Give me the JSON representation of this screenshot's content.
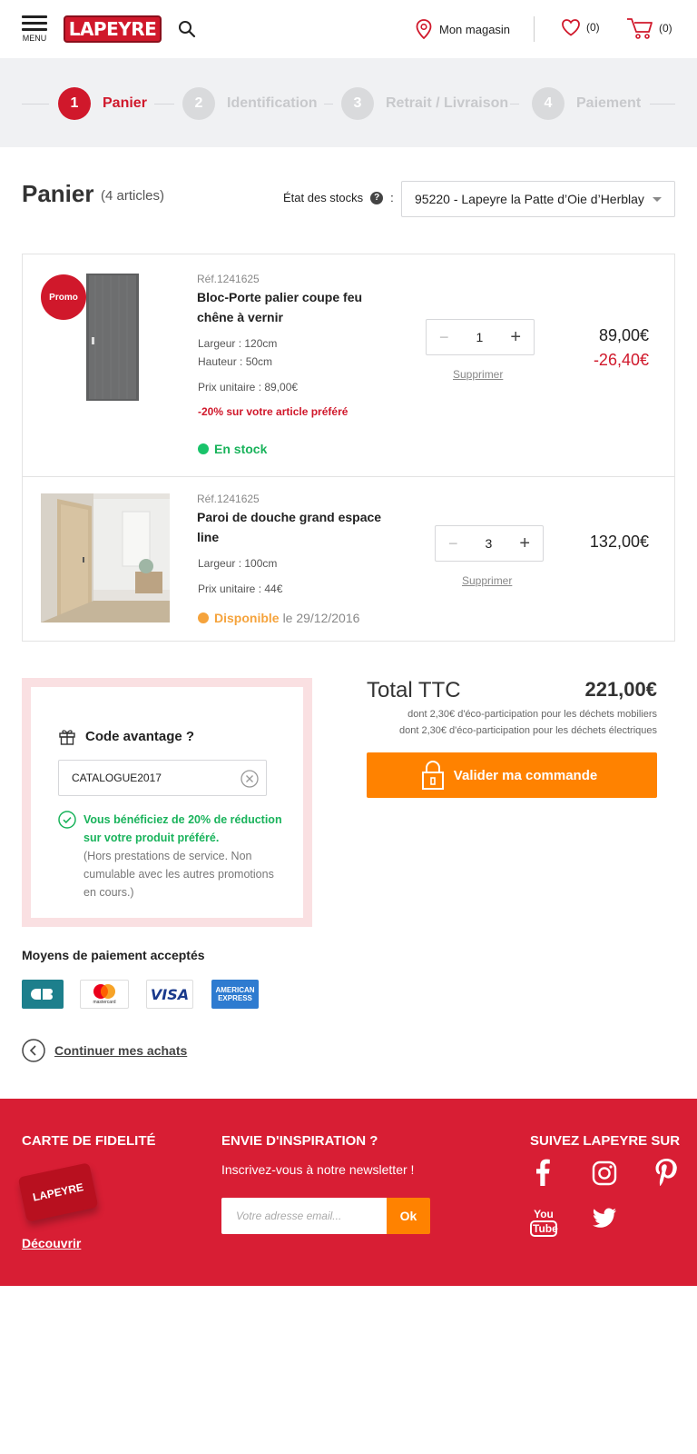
{
  "header": {
    "menu_label": "MENU",
    "logo_text": "LAPEYRE",
    "store_label": "Mon magasin",
    "favorites_count": "(0)",
    "cart_count": "(0)"
  },
  "stepper": [
    {
      "number": "1",
      "label": "Panier",
      "active": true
    },
    {
      "number": "2",
      "label": "Identification",
      "active": false
    },
    {
      "number": "3",
      "label": "Retrait / Livraison",
      "active": false
    },
    {
      "number": "4",
      "label": "Paiement",
      "active": false
    }
  ],
  "cart": {
    "title": "Panier",
    "count_label": "(4 articles)",
    "stock_label": "État des stocks",
    "stock_separator": ":",
    "store_selected": "95220 - Lapeyre la Patte d’Oie d’Herblay",
    "items": [
      {
        "badge": "Promo",
        "ref": "Réf.1241625",
        "name": "Bloc-Porte palier coupe feu chêne à vernir",
        "spec1": "Largeur : 120cm",
        "spec2": "Hauteur : 50cm",
        "unit_price": "Prix unitaire : 89,00€",
        "promo_note": "-20% sur votre article préféré",
        "availability": "En stock",
        "availability_color": "#19c36a",
        "quantity": "1",
        "remove_label": "Supprimer",
        "price": "89,00€",
        "discount": "-26,40€"
      },
      {
        "ref": "Réf.1241625",
        "name": "Paroi de douche grand espace line",
        "spec1": "Largeur : 100cm",
        "unit_price": "Prix unitaire : 44€",
        "availability": "Disponible",
        "availability_date": "le 29/12/2016",
        "availability_color": "#f5a33c",
        "quantity": "3",
        "remove_label": "Supprimer",
        "price": "132,00€"
      }
    ]
  },
  "promo_code": {
    "title": "Code avantage ?",
    "value": "CATALOGUE2017",
    "success": "Vous bénéficiez de 20% de réduction sur votre produit préféré.",
    "note": "(Hors prestations de service. Non cumulable avec les autres promotions en cours.)"
  },
  "totals": {
    "label": "Total TTC",
    "value": "221,00€",
    "eco_furniture": "dont 2,30€ d'éco-participation pour les déchets mobiliers",
    "eco_electric": "dont 2,30€ d'éco-participation pour les déchets électriques",
    "validate_label": "Valider ma commande"
  },
  "payment": {
    "title": "Moyens de paiement acceptés",
    "cards": [
      "CB",
      "mastercard",
      "VISA",
      "AMERICAN EXPRESS"
    ]
  },
  "continue_label": "Continuer mes achats",
  "footer": {
    "loyalty_title": "CARTE DE FIDELITÉ",
    "loyalty_card_text": "LAPEYRE",
    "discover_label": "Découvrir",
    "inspiration_title": "ENVIE D'INSPIRATION ?",
    "newsletter_label": "Inscrivez-vous à notre newsletter !",
    "email_placeholder": "Votre adresse email...",
    "ok_label": "Ok",
    "social_title": "SUIVEZ LAPEYRE SUR",
    "youtube_line1": "You",
    "youtube_line2": "Tube"
  },
  "colors": {
    "brand_red": "#d0182b",
    "footer_red": "#d81e34",
    "cta_orange": "#ff8200",
    "success_green": "#19b35b"
  }
}
